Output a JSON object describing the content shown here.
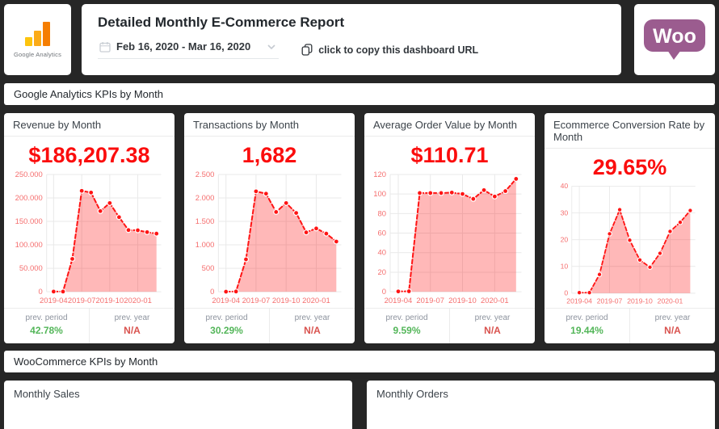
{
  "header": {
    "ga_badge": {
      "label": "Google Analytics"
    },
    "title": "Detailed Monthly E-Commerce Report",
    "date_range": {
      "value": "Feb 16, 2020 - Mar 16, 2020"
    },
    "copy_button": {
      "label": "click to copy this dashboard URL"
    },
    "woo_badge": {
      "label": "Woo",
      "color": "#9b5c8f"
    }
  },
  "sections": [
    {
      "title": "Google Analytics KPIs by Month"
    },
    {
      "title": "WooCommerce KPIs by Month"
    }
  ],
  "kpis": [
    {
      "title": "Revenue by Month",
      "value": "$186,207.38",
      "prev_period_label": "prev. period",
      "prev_period_value": "42.78%",
      "prev_year_label": "prev. year",
      "prev_year_value": "N/A"
    },
    {
      "title": "Transactions by Month",
      "value": "1,682",
      "prev_period_label": "prev. period",
      "prev_period_value": "30.29%",
      "prev_year_label": "prev. year",
      "prev_year_value": "N/A"
    },
    {
      "title": "Average Order Value by Month",
      "value": "$110.71",
      "prev_period_label": "prev. period",
      "prev_period_value": "9.59%",
      "prev_year_label": "prev. year",
      "prev_year_value": "N/A"
    },
    {
      "title": "Ecommerce Conversion Rate by Month",
      "value": "29.65%",
      "prev_period_label": "prev. period",
      "prev_period_value": "19.44%",
      "prev_year_label": "prev. year",
      "prev_year_value": "N/A"
    }
  ],
  "bottom_cards": [
    {
      "title": "Monthly Sales"
    },
    {
      "title": "Monthly Orders"
    }
  ],
  "chart_style": {
    "line": "#ff1414",
    "fill": "rgba(255,20,20,0.30)",
    "tick_color": "#f56e6e",
    "grid": "#e9e9e9",
    "value_color": "#fb0d0d",
    "positive": "#53b659",
    "negative": "#d9534f"
  },
  "chart_data": [
    {
      "type": "area",
      "title": "Revenue by Month",
      "x": [
        "2019-04",
        "2019-05",
        "2019-06",
        "2019-07",
        "2019-08",
        "2019-09",
        "2019-10",
        "2019-11",
        "2019-12",
        "2020-01",
        "2020-02",
        "2020-03"
      ],
      "values": [
        300,
        400,
        70000,
        215000,
        211500,
        172000,
        189000,
        159000,
        131500,
        131000,
        127000,
        124000
      ],
      "ylim": [
        0,
        250000
      ],
      "yticks": [
        {
          "v": 0,
          "label": "0"
        },
        {
          "v": 50000,
          "label": "50.000"
        },
        {
          "v": 100000,
          "label": "100.000"
        },
        {
          "v": 150000,
          "label": "150.000"
        },
        {
          "v": 200000,
          "label": "200.000"
        },
        {
          "v": 250000,
          "label": "250.000"
        }
      ],
      "xticks": [
        {
          "i": 0,
          "label": "2019-04"
        },
        {
          "i": 3,
          "label": "2019-07"
        },
        {
          "i": 6,
          "label": "2019-10"
        },
        {
          "i": 9,
          "label": "2020-01"
        }
      ]
    },
    {
      "type": "area",
      "title": "Transactions by Month",
      "x": [
        "2019-04",
        "2019-05",
        "2019-06",
        "2019-07",
        "2019-08",
        "2019-09",
        "2019-10",
        "2019-11",
        "2019-12",
        "2020-01",
        "2020-02",
        "2020-03"
      ],
      "values": [
        2,
        5,
        690,
        2140,
        2090,
        1700,
        1890,
        1680,
        1265,
        1350,
        1240,
        1070
      ],
      "ylim": [
        0,
        2500
      ],
      "yticks": [
        {
          "v": 0,
          "label": "0"
        },
        {
          "v": 500,
          "label": "500"
        },
        {
          "v": 1000,
          "label": "1.000"
        },
        {
          "v": 1500,
          "label": "1.500"
        },
        {
          "v": 2000,
          "label": "2.000"
        },
        {
          "v": 2500,
          "label": "2.500"
        }
      ],
      "xticks": [
        {
          "i": 0,
          "label": "2019-04"
        },
        {
          "i": 3,
          "label": "2019-07"
        },
        {
          "i": 6,
          "label": "2019-10"
        },
        {
          "i": 9,
          "label": "2020-01"
        }
      ]
    },
    {
      "type": "area",
      "title": "Average Order Value by Month",
      "x": [
        "2019-04",
        "2019-05",
        "2019-06",
        "2019-07",
        "2019-08",
        "2019-09",
        "2019-10",
        "2019-11",
        "2019-12",
        "2020-01",
        "2020-02",
        "2020-03"
      ],
      "values": [
        0.3,
        0.5,
        101,
        101,
        101,
        101.5,
        100,
        95,
        104,
        97.5,
        103,
        115.5
      ],
      "ylim": [
        0,
        120
      ],
      "yticks": [
        {
          "v": 0,
          "label": "0"
        },
        {
          "v": 20,
          "label": "20"
        },
        {
          "v": 40,
          "label": "40"
        },
        {
          "v": 60,
          "label": "60"
        },
        {
          "v": 80,
          "label": "80"
        },
        {
          "v": 100,
          "label": "100"
        },
        {
          "v": 120,
          "label": "120"
        }
      ],
      "xticks": [
        {
          "i": 0,
          "label": "2019-04"
        },
        {
          "i": 3,
          "label": "2019-07"
        },
        {
          "i": 6,
          "label": "2019-10"
        },
        {
          "i": 9,
          "label": "2020-01"
        }
      ]
    },
    {
      "type": "area",
      "title": "Ecommerce Conversion Rate by Month",
      "x": [
        "2019-04",
        "2019-05",
        "2019-06",
        "2019-07",
        "2019-08",
        "2019-09",
        "2019-10",
        "2019-11",
        "2019-12",
        "2020-01",
        "2020-02",
        "2020-03"
      ],
      "values": [
        0.2,
        0.2,
        7,
        22.2,
        31.2,
        19.8,
        12.4,
        9.7,
        14.9,
        23.1,
        26.5,
        30.9
      ],
      "ylim": [
        0,
        40
      ],
      "yticks": [
        {
          "v": 0,
          "label": "0"
        },
        {
          "v": 10,
          "label": "10"
        },
        {
          "v": 20,
          "label": "20"
        },
        {
          "v": 30,
          "label": "30"
        },
        {
          "v": 40,
          "label": "40"
        }
      ],
      "xticks": [
        {
          "i": 0,
          "label": "2019-04"
        },
        {
          "i": 3,
          "label": "2019-07"
        },
        {
          "i": 6,
          "label": "2019-10"
        },
        {
          "i": 9,
          "label": "2020-01"
        }
      ]
    }
  ]
}
